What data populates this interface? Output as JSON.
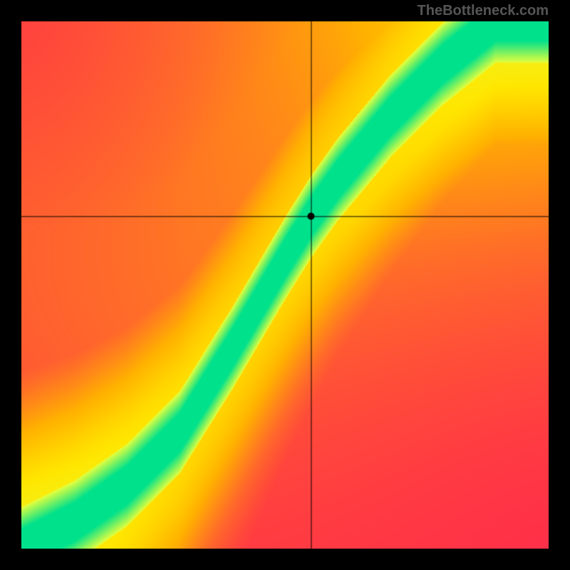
{
  "watermark": "TheBottleneck.com",
  "chart_data": {
    "type": "heatmap",
    "title": "",
    "xlabel": "",
    "ylabel": "",
    "xlim": [
      0,
      100
    ],
    "ylim": [
      0,
      100
    ],
    "crosshair": {
      "x": 55,
      "y": 63
    },
    "marker": {
      "x": 55,
      "y": 63
    },
    "ridge": [
      {
        "x": 0,
        "y": 0
      },
      {
        "x": 10,
        "y": 5
      },
      {
        "x": 20,
        "y": 12
      },
      {
        "x": 30,
        "y": 22
      },
      {
        "x": 40,
        "y": 38
      },
      {
        "x": 50,
        "y": 55
      },
      {
        "x": 55,
        "y": 63
      },
      {
        "x": 60,
        "y": 70
      },
      {
        "x": 70,
        "y": 82
      },
      {
        "x": 80,
        "y": 92
      },
      {
        "x": 90,
        "y": 100
      }
    ],
    "ridge_width_pct": 6,
    "colormap": [
      "#ff2b4a",
      "#ff6a2a",
      "#ffb200",
      "#ffe600",
      "#e4ff3a",
      "#8cff5c",
      "#25e68c"
    ],
    "corner_bias": {
      "bottom_left": 0.02,
      "top_right": 0.55,
      "bottom_right": 0.0,
      "top_left": 0.0
    }
  }
}
